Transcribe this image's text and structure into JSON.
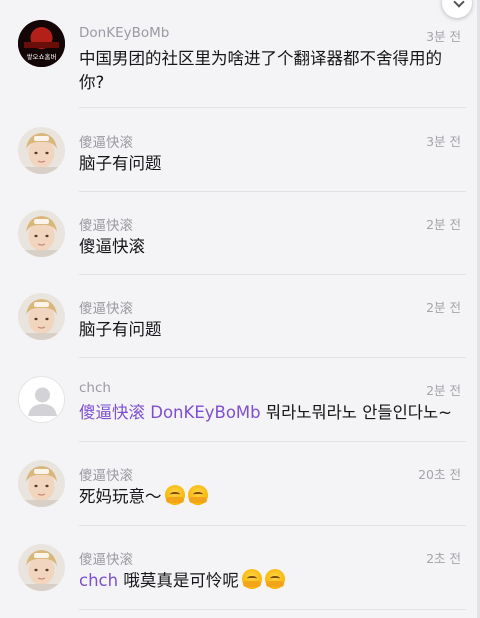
{
  "comments": [
    {
      "user": "DonKEyBoMb",
      "time": "3분 전",
      "text": "中国男团的社区里为啥进了个翻译器都不舍得用的你?",
      "avatar": "red-logo-avatar"
    },
    {
      "user": "傻逼快滚",
      "time": "3분 전",
      "text": "脑子有问题",
      "avatar": "person-photo-avatar"
    },
    {
      "user": "傻逼快滚",
      "time": "2분 전",
      "text": "傻逼快滚",
      "avatar": "person-photo-avatar"
    },
    {
      "user": "傻逼快滚",
      "time": "2분 전",
      "text": "脑子有问题",
      "avatar": "person-photo-avatar"
    },
    {
      "user": "chch",
      "time": "2분 전",
      "mention1": "傻逼快滚",
      "mention2": "DonKEyBoMb",
      "text": "뭐라노뭐라노 안들인다노~",
      "avatar": "default-gray-avatar"
    },
    {
      "user": "傻逼快滚",
      "time": "20초 전",
      "text": "死妈玩意～",
      "avatar": "person-photo-avatar"
    },
    {
      "user": "傻逼快滚",
      "time": "2초 전",
      "mention1": "chch",
      "text": "哦莫真是可怜呢",
      "avatar": "person-photo-avatar"
    }
  ],
  "avatar_logo_text": "쌓오쇼홈버",
  "colors": {
    "mention": "#7e4fd1",
    "background": "#f4f4f6"
  }
}
